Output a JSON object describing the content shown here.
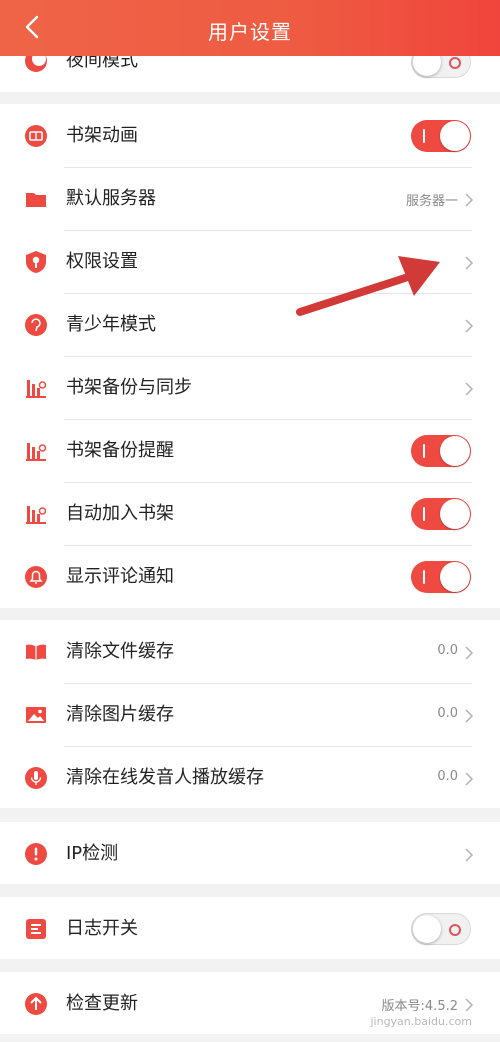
{
  "header": {
    "title": "用户设置"
  },
  "groups": [
    {
      "items": [
        {
          "label": "夜间模式",
          "icon": "moon-icon",
          "control": "toggle",
          "on": false
        }
      ]
    },
    {
      "items": [
        {
          "label": "书架动画",
          "icon": "bookshelf-animation-icon",
          "control": "toggle",
          "on": true
        },
        {
          "label": "默认服务器",
          "icon": "folder-icon",
          "control": "chevron",
          "value": "服务器一"
        },
        {
          "label": "权限设置",
          "icon": "shield-icon",
          "control": "chevron"
        },
        {
          "label": "青少年模式",
          "icon": "youth-mode-icon",
          "control": "chevron"
        },
        {
          "label": "书架备份与同步",
          "icon": "backup-sync-icon",
          "control": "chevron"
        },
        {
          "label": "书架备份提醒",
          "icon": "backup-reminder-icon",
          "control": "toggle",
          "on": true
        },
        {
          "label": "自动加入书架",
          "icon": "auto-add-icon",
          "control": "toggle",
          "on": true
        },
        {
          "label": "显示评论通知",
          "icon": "bell-icon",
          "control": "toggle",
          "on": true
        }
      ]
    },
    {
      "items": [
        {
          "label": "清除文件缓存",
          "icon": "book-icon",
          "control": "chevron",
          "value": "0.0"
        },
        {
          "label": "清除图片缓存",
          "icon": "image-icon",
          "control": "chevron",
          "value": "0.0"
        },
        {
          "label": "清除在线发音人播放缓存",
          "icon": "microphone-icon",
          "control": "chevron",
          "value": "0.0"
        }
      ]
    },
    {
      "items": [
        {
          "label": "IP检测",
          "icon": "alert-icon",
          "control": "chevron"
        }
      ]
    },
    {
      "items": [
        {
          "label": "日志开关",
          "icon": "log-icon",
          "control": "toggle",
          "on": false
        }
      ]
    },
    {
      "items": [
        {
          "label": "检查更新",
          "icon": "upload-icon",
          "control": "chevron",
          "value": "版本号:4.5.2"
        }
      ]
    }
  ],
  "watermark": "jingyan.baidu.com",
  "colors": {
    "accent": "#ee4a42",
    "header": "#ef5a43"
  }
}
